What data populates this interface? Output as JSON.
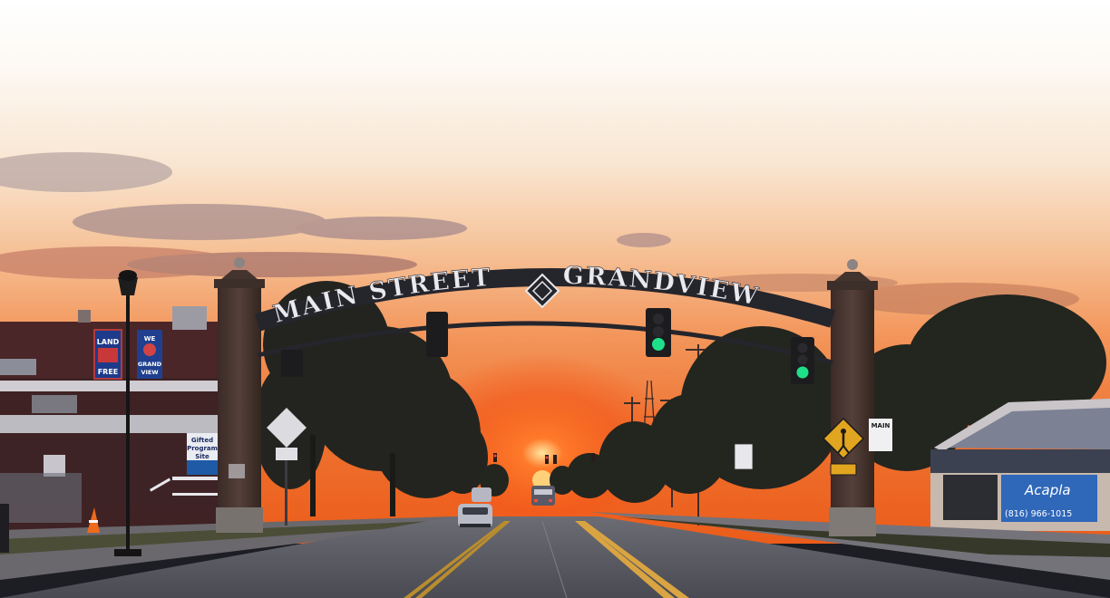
{
  "arch": {
    "left_text": "MAIN STREET",
    "right_text": "GRANDVIEW"
  },
  "banners": {
    "land_line1": "LAND",
    "land_line2": "FREE",
    "grand_line1": "WE",
    "grand_line2": "GRAND",
    "grand_line3": "VIEW"
  },
  "building_sign": {
    "line1": "Gifted",
    "line2": "Program",
    "line3": "Site"
  },
  "street_sign": {
    "text": "MAIN"
  },
  "storefront": {
    "brand": "Acapla",
    "phone": "(816) 966-1015"
  },
  "colors": {
    "sky_top": "#fdfdfb",
    "sky_mid": "#f6c9a2",
    "sky_horizon": "#f07a2e",
    "sun_glow": "#ff5a12",
    "signal_green": "#1fe08a"
  }
}
